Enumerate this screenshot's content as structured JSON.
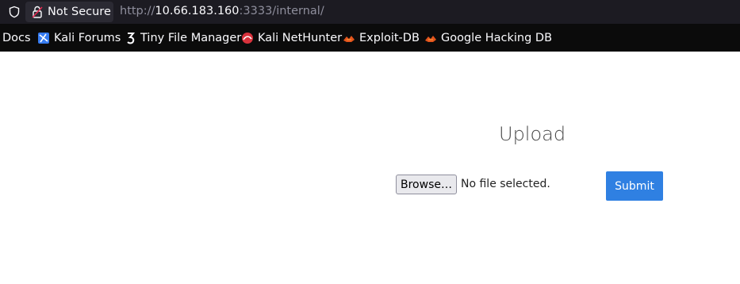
{
  "browser": {
    "security_label": "Not Secure",
    "url": {
      "scheme": "http://",
      "host": "10.66.183.160",
      "rest": ":3333/internal/"
    }
  },
  "bookmarks": [
    {
      "label": "Docs",
      "icon": "none"
    },
    {
      "label": "Kali Forums",
      "icon": "kali-forums-icon"
    },
    {
      "label": "Tiny File Manager",
      "icon": "tiny-file-manager-icon"
    },
    {
      "label": "Kali NetHunter",
      "icon": "nethunter-icon"
    },
    {
      "label": "Exploit-DB",
      "icon": "exploit-db-icon"
    },
    {
      "label": "Google Hacking DB",
      "icon": "ghdb-icon"
    }
  ],
  "form": {
    "title": "Upload",
    "browse_label": "Browse…",
    "file_status": "No file selected.",
    "submit_label": "Submit"
  },
  "colors": {
    "toolbar_bg": "#1c1b22",
    "bookmarks_bg": "#0b0b0b",
    "submit_bg": "#2f80e2"
  }
}
